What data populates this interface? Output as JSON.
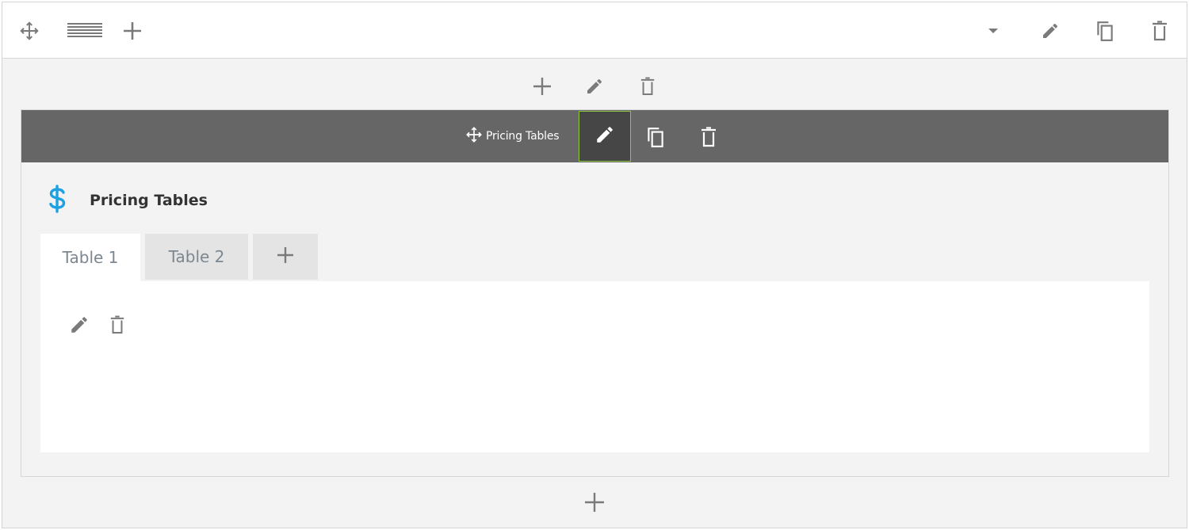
{
  "row_toolbar": {
    "left_icons": [
      "move-arrows-icon",
      "row-layout-icon",
      "plus-icon"
    ],
    "right_icons": [
      "caret-down-icon",
      "pencil-icon",
      "copy-icon",
      "trash-icon"
    ]
  },
  "column_actions": {
    "icons": [
      "plus-icon",
      "pencil-icon",
      "trash-icon"
    ]
  },
  "module": {
    "bar_label": "Pricing Tables",
    "bar_icons": [
      "move-arrows-icon",
      "pencil-icon",
      "copy-icon",
      "trash-icon"
    ],
    "icon": "dollar-icon",
    "title": "Pricing Tables",
    "tabs": [
      {
        "label": "Table 1",
        "active": true
      },
      {
        "label": "Table 2",
        "active": false
      }
    ],
    "add_tab_icon": "plus-icon",
    "panel_icons": [
      "pencil-icon",
      "trash-icon"
    ]
  },
  "add_bottom_icon": "plus-icon",
  "colors": {
    "module_bar": "#666666",
    "active_edit_border": "#8dc63f",
    "dollar_icon": "#1da1e2",
    "icon_gray": "#7a7a7a",
    "tab_text": "#7c8791"
  }
}
